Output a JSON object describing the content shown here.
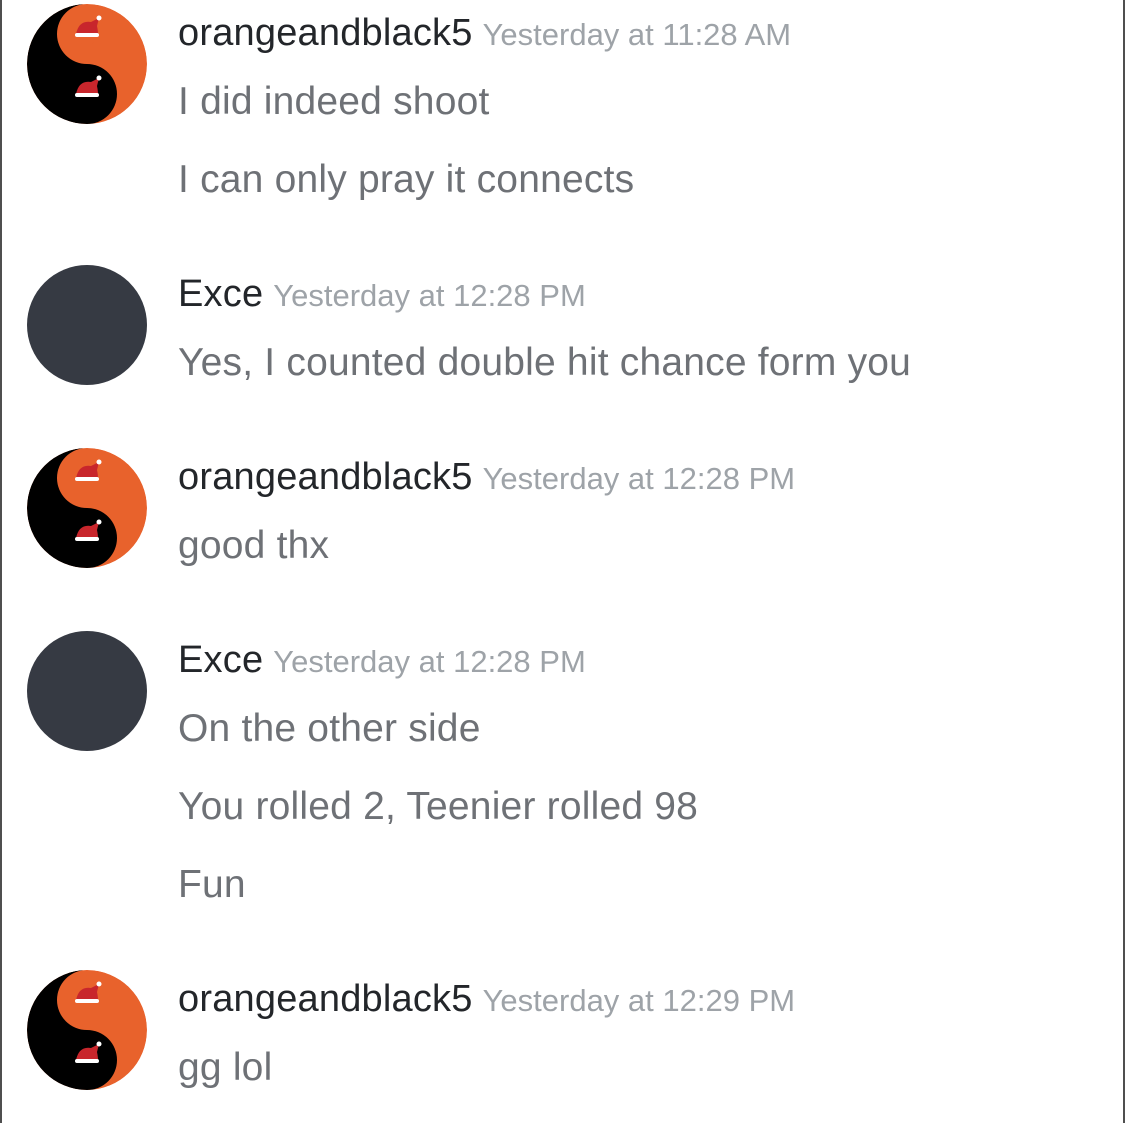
{
  "messages": [
    {
      "username": "orangeandblack5",
      "timestamp": "Yesterday at 11:28 AM",
      "avatar": "yin-yang-santa-avatar",
      "lines": [
        "I did indeed shoot",
        "I can only pray it connects"
      ]
    },
    {
      "username": "Exce",
      "timestamp": "Yesterday at 12:28 PM",
      "avatar": "default-dark-avatar",
      "lines": [
        "Yes, I counted double hit chance form you"
      ]
    },
    {
      "username": "orangeandblack5",
      "timestamp": "Yesterday at 12:28 PM",
      "avatar": "yin-yang-santa-avatar",
      "lines": [
        "good thx"
      ]
    },
    {
      "username": "Exce",
      "timestamp": "Yesterday at 12:28 PM",
      "avatar": "default-dark-avatar",
      "lines": [
        "On the other side",
        "You rolled 2, Teenier rolled 98",
        "Fun"
      ]
    },
    {
      "username": "orangeandblack5",
      "timestamp": "Yesterday at 12:29 PM",
      "avatar": "yin-yang-santa-avatar",
      "lines": [
        "gg lol"
      ]
    }
  ],
  "colors": {
    "username": "#23262a",
    "timestamp": "#9ea3a8",
    "message": "#6e7176",
    "avatar_orange": "#e8622c",
    "avatar_black": "#000000",
    "avatar_dark": "#363a43"
  }
}
